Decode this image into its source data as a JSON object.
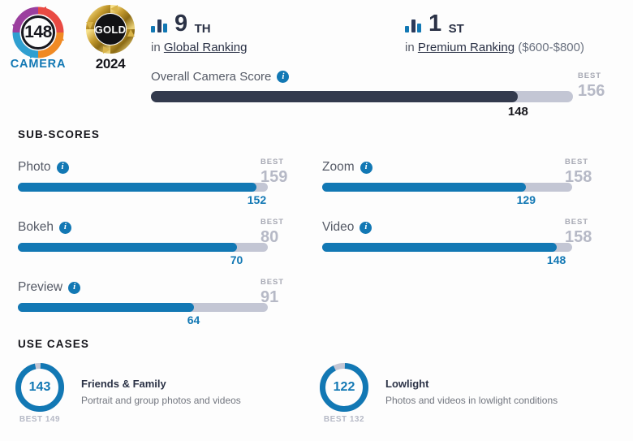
{
  "colors": {
    "blue": "#1278b4",
    "dark_bar": "#333a4d",
    "track": "#c3c6d4",
    "best_text": "#b6b9c6",
    "navy": "#2b3246",
    "background": "#fdfdfd"
  },
  "header": {
    "camera_badge": {
      "score": "148",
      "label": "CAMERA",
      "icon": "dxomark-ring-logo"
    },
    "gold_badge": {
      "award": "GOLD",
      "year": "2024",
      "icon": "gold-award-badge"
    },
    "rankings": [
      {
        "icon": "bar-chart-icon",
        "rank": "9",
        "suffix": "TH",
        "prefix": "in",
        "link": "Global Ranking",
        "note": ""
      },
      {
        "icon": "bar-chart-icon",
        "rank": "1",
        "suffix": "ST",
        "prefix": "in",
        "link": "Premium Ranking",
        "note": "($600-$800)"
      }
    ]
  },
  "overall": {
    "label": "Overall Camera Score",
    "info_icon": "info-icon",
    "score": "148",
    "best_caption": "BEST",
    "best": "156",
    "percent": 87
  },
  "sections": {
    "sub_scores_title": "SUB-SCORES",
    "use_cases_title": "USE CASES"
  },
  "sub_scores": [
    {
      "name": "Photo",
      "score": "152",
      "best_caption": "BEST",
      "best": "159",
      "percent": 95.6
    },
    {
      "name": "Zoom",
      "score": "129",
      "best_caption": "BEST",
      "best": "158",
      "percent": 81.6
    },
    {
      "name": "Bokeh",
      "score": "70",
      "best_caption": "BEST",
      "best": "80",
      "percent": 87.5
    },
    {
      "name": "Video",
      "score": "148",
      "best_caption": "BEST",
      "best": "158",
      "percent": 93.7
    },
    {
      "name": "Preview",
      "score": "64",
      "best_caption": "BEST",
      "best": "91",
      "percent": 70.3
    }
  ],
  "use_cases": [
    {
      "score": "143",
      "best_label": "BEST 149",
      "title": "Friends & Family",
      "description": "Portrait and group photos and videos",
      "percent": 96
    },
    {
      "score": "122",
      "best_label": "BEST 132",
      "title": "Lowlight",
      "description": "Photos and videos in lowlight conditions",
      "percent": 92
    }
  ],
  "chart_data": {
    "type": "bar",
    "title": "DXOMARK Camera Scores",
    "categories": [
      "Overall Camera Score",
      "Photo",
      "Zoom",
      "Bokeh",
      "Video",
      "Preview",
      "Friends & Family",
      "Lowlight"
    ],
    "values": [
      148,
      152,
      129,
      70,
      148,
      64,
      143,
      122
    ],
    "best_values": [
      156,
      159,
      158,
      80,
      158,
      91,
      149,
      132
    ],
    "series": [
      {
        "name": "Score",
        "values": [
          148,
          152,
          129,
          70,
          148,
          64,
          143,
          122
        ]
      },
      {
        "name": "Best",
        "values": [
          156,
          159,
          158,
          80,
          158,
          91,
          149,
          132
        ]
      }
    ],
    "xlabel": "",
    "ylabel": "Score",
    "grid": false,
    "legend": "none"
  }
}
